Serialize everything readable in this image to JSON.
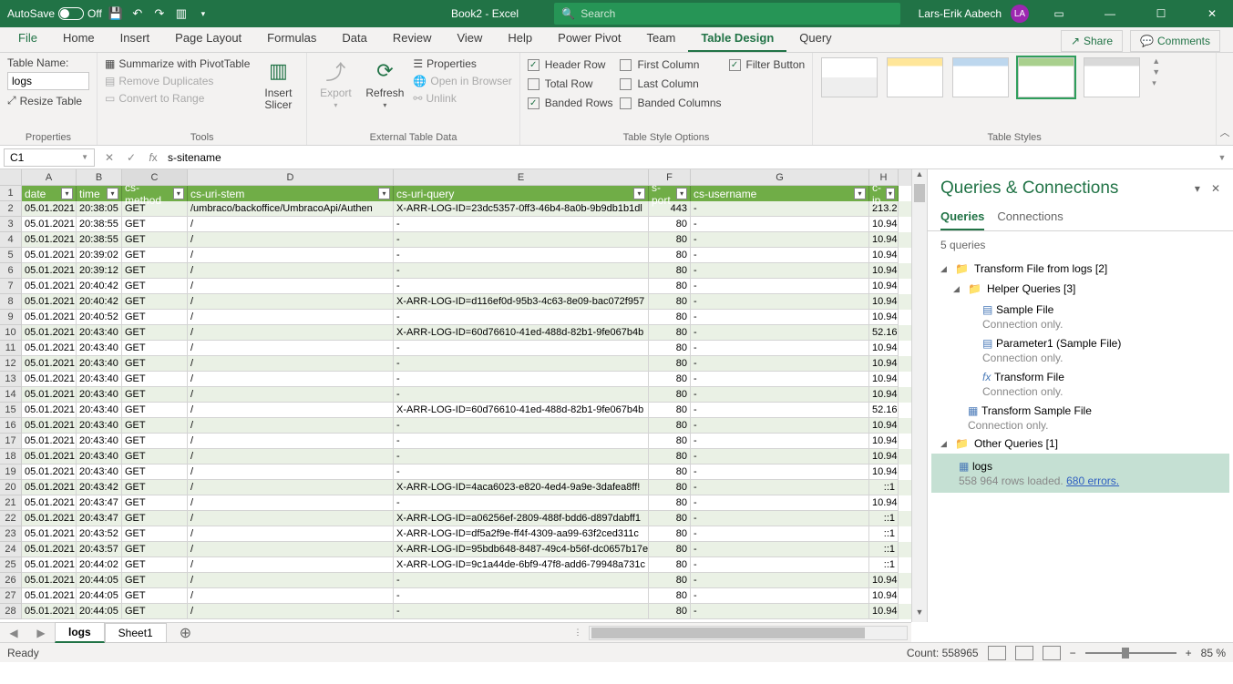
{
  "titlebar": {
    "autosave_label": "AutoSave",
    "autosave_state": "Off",
    "doc_title": "Book2 - Excel",
    "search_placeholder": "Search",
    "user_name": "Lars-Erik Aabech",
    "user_initials": "LA"
  },
  "ribbon_tabs": [
    "File",
    "Home",
    "Insert",
    "Page Layout",
    "Formulas",
    "Data",
    "Review",
    "View",
    "Help",
    "Power Pivot",
    "Team",
    "Table Design",
    "Query"
  ],
  "active_tab": "Table Design",
  "share_label": "Share",
  "comments_label": "Comments",
  "ribbon": {
    "properties": {
      "label": "Properties",
      "table_name_label": "Table Name:",
      "table_name_value": "logs",
      "resize_label": "Resize Table"
    },
    "tools": {
      "label": "Tools",
      "summarize": "Summarize with PivotTable",
      "remove_dup": "Remove Duplicates",
      "convert": "Convert to Range",
      "insert_slicer": "Insert Slicer"
    },
    "external": {
      "label": "External Table Data",
      "export": "Export",
      "refresh": "Refresh",
      "properties": "Properties",
      "open_browser": "Open in Browser",
      "unlink": "Unlink"
    },
    "style_options": {
      "label": "Table Style Options",
      "header_row": "Header Row",
      "total_row": "Total Row",
      "banded_rows": "Banded Rows",
      "first_col": "First Column",
      "last_col": "Last Column",
      "banded_cols": "Banded Columns",
      "filter_btn": "Filter Button"
    },
    "styles_label": "Table Styles"
  },
  "formula_bar": {
    "cell_ref": "C1",
    "value": "s-sitename"
  },
  "columns": [
    "A",
    "B",
    "C",
    "D",
    "E",
    "F",
    "G",
    "H"
  ],
  "table_headers": [
    "date",
    "time",
    "cs-method",
    "cs-uri-stem",
    "cs-uri-query",
    "s-port",
    "cs-username",
    "c-ip"
  ],
  "rows": [
    {
      "n": 2,
      "A": "05.01.2021",
      "B": "20:38:05",
      "C": "GET",
      "D": "/umbraco/backoffice/UmbracoApi/Authen",
      "E": "X-ARR-LOG-ID=23dc5357-0ff3-46b4-8a0b-9b9db1b1dl",
      "F": "443",
      "G": "-",
      "H": "213.2"
    },
    {
      "n": 3,
      "A": "05.01.2021",
      "B": "20:38:55",
      "C": "GET",
      "D": "/",
      "E": "-",
      "F": "80",
      "G": "-",
      "H": "10.94"
    },
    {
      "n": 4,
      "A": "05.01.2021",
      "B": "20:38:55",
      "C": "GET",
      "D": "/",
      "E": "-",
      "F": "80",
      "G": "-",
      "H": "10.94"
    },
    {
      "n": 5,
      "A": "05.01.2021",
      "B": "20:39:02",
      "C": "GET",
      "D": "/",
      "E": "-",
      "F": "80",
      "G": "-",
      "H": "10.94"
    },
    {
      "n": 6,
      "A": "05.01.2021",
      "B": "20:39:12",
      "C": "GET",
      "D": "/",
      "E": "-",
      "F": "80",
      "G": "-",
      "H": "10.94"
    },
    {
      "n": 7,
      "A": "05.01.2021",
      "B": "20:40:42",
      "C": "GET",
      "D": "/",
      "E": "-",
      "F": "80",
      "G": "-",
      "H": "10.94"
    },
    {
      "n": 8,
      "A": "05.01.2021",
      "B": "20:40:42",
      "C": "GET",
      "D": "/",
      "E": "X-ARR-LOG-ID=d116ef0d-95b3-4c63-8e09-bac072f957",
      "F": "80",
      "G": "-",
      "H": "10.94"
    },
    {
      "n": 9,
      "A": "05.01.2021",
      "B": "20:40:52",
      "C": "GET",
      "D": "/",
      "E": "-",
      "F": "80",
      "G": "-",
      "H": "10.94"
    },
    {
      "n": 10,
      "A": "05.01.2021",
      "B": "20:43:40",
      "C": "GET",
      "D": "/",
      "E": "X-ARR-LOG-ID=60d76610-41ed-488d-82b1-9fe067b4b",
      "F": "80",
      "G": "-",
      "H": "52.16"
    },
    {
      "n": 11,
      "A": "05.01.2021",
      "B": "20:43:40",
      "C": "GET",
      "D": "/",
      "E": "-",
      "F": "80",
      "G": "-",
      "H": "10.94"
    },
    {
      "n": 12,
      "A": "05.01.2021",
      "B": "20:43:40",
      "C": "GET",
      "D": "/",
      "E": "-",
      "F": "80",
      "G": "-",
      "H": "10.94"
    },
    {
      "n": 13,
      "A": "05.01.2021",
      "B": "20:43:40",
      "C": "GET",
      "D": "/",
      "E": "-",
      "F": "80",
      "G": "-",
      "H": "10.94"
    },
    {
      "n": 14,
      "A": "05.01.2021",
      "B": "20:43:40",
      "C": "GET",
      "D": "/",
      "E": "-",
      "F": "80",
      "G": "-",
      "H": "10.94"
    },
    {
      "n": 15,
      "A": "05.01.2021",
      "B": "20:43:40",
      "C": "GET",
      "D": "/",
      "E": "X-ARR-LOG-ID=60d76610-41ed-488d-82b1-9fe067b4b",
      "F": "80",
      "G": "-",
      "H": "52.16"
    },
    {
      "n": 16,
      "A": "05.01.2021",
      "B": "20:43:40",
      "C": "GET",
      "D": "/",
      "E": "-",
      "F": "80",
      "G": "-",
      "H": "10.94"
    },
    {
      "n": 17,
      "A": "05.01.2021",
      "B": "20:43:40",
      "C": "GET",
      "D": "/",
      "E": "-",
      "F": "80",
      "G": "-",
      "H": "10.94"
    },
    {
      "n": 18,
      "A": "05.01.2021",
      "B": "20:43:40",
      "C": "GET",
      "D": "/",
      "E": "-",
      "F": "80",
      "G": "-",
      "H": "10.94"
    },
    {
      "n": 19,
      "A": "05.01.2021",
      "B": "20:43:40",
      "C": "GET",
      "D": "/",
      "E": "-",
      "F": "80",
      "G": "-",
      "H": "10.94"
    },
    {
      "n": 20,
      "A": "05.01.2021",
      "B": "20:43:42",
      "C": "GET",
      "D": "/",
      "E": "X-ARR-LOG-ID=4aca6023-e820-4ed4-9a9e-3dafea8ff!",
      "F": "80",
      "G": "-",
      "H": "::1"
    },
    {
      "n": 21,
      "A": "05.01.2021",
      "B": "20:43:47",
      "C": "GET",
      "D": "/",
      "E": "-",
      "F": "80",
      "G": "-",
      "H": "10.94"
    },
    {
      "n": 22,
      "A": "05.01.2021",
      "B": "20:43:47",
      "C": "GET",
      "D": "/",
      "E": "X-ARR-LOG-ID=a06256ef-2809-488f-bdd6-d897dabff1",
      "F": "80",
      "G": "-",
      "H": "::1"
    },
    {
      "n": 23,
      "A": "05.01.2021",
      "B": "20:43:52",
      "C": "GET",
      "D": "/",
      "E": "X-ARR-LOG-ID=df5a2f9e-ff4f-4309-aa99-63f2ced311c",
      "F": "80",
      "G": "-",
      "H": "::1"
    },
    {
      "n": 24,
      "A": "05.01.2021",
      "B": "20:43:57",
      "C": "GET",
      "D": "/",
      "E": "X-ARR-LOG-ID=95bdb648-8487-49c4-b56f-dc0657b17e",
      "F": "80",
      "G": "-",
      "H": "::1"
    },
    {
      "n": 25,
      "A": "05.01.2021",
      "B": "20:44:02",
      "C": "GET",
      "D": "/",
      "E": "X-ARR-LOG-ID=9c1a44de-6bf9-47f8-add6-79948a731c",
      "F": "80",
      "G": "-",
      "H": "::1"
    },
    {
      "n": 26,
      "A": "05.01.2021",
      "B": "20:44:05",
      "C": "GET",
      "D": "/",
      "E": "-",
      "F": "80",
      "G": "-",
      "H": "10.94"
    },
    {
      "n": 27,
      "A": "05.01.2021",
      "B": "20:44:05",
      "C": "GET",
      "D": "/",
      "E": "-",
      "F": "80",
      "G": "-",
      "H": "10.94"
    },
    {
      "n": 28,
      "A": "05.01.2021",
      "B": "20:44:05",
      "C": "GET",
      "D": "/",
      "E": "-",
      "F": "80",
      "G": "-",
      "H": "10.94"
    }
  ],
  "sheet_tabs": [
    "logs",
    "Sheet1"
  ],
  "active_sheet": "logs",
  "panel": {
    "title": "Queries & Connections",
    "tabs": [
      "Queries",
      "Connections"
    ],
    "count_label": "5 queries",
    "groups": {
      "transform": "Transform File from logs [2]",
      "helper": "Helper Queries [3]",
      "sample_file": "Sample File",
      "param1": "Parameter1 (Sample File)",
      "transform_file": "Transform File",
      "transform_sample": "Transform Sample File",
      "conn_only": "Connection only.",
      "other": "Other Queries [1]",
      "logs": "logs",
      "logs_sub_pre": "558 964 rows loaded. ",
      "logs_sub_err": "680 errors."
    }
  },
  "status": {
    "ready": "Ready",
    "count_label": "Count: 558965",
    "zoom": "85 %"
  }
}
